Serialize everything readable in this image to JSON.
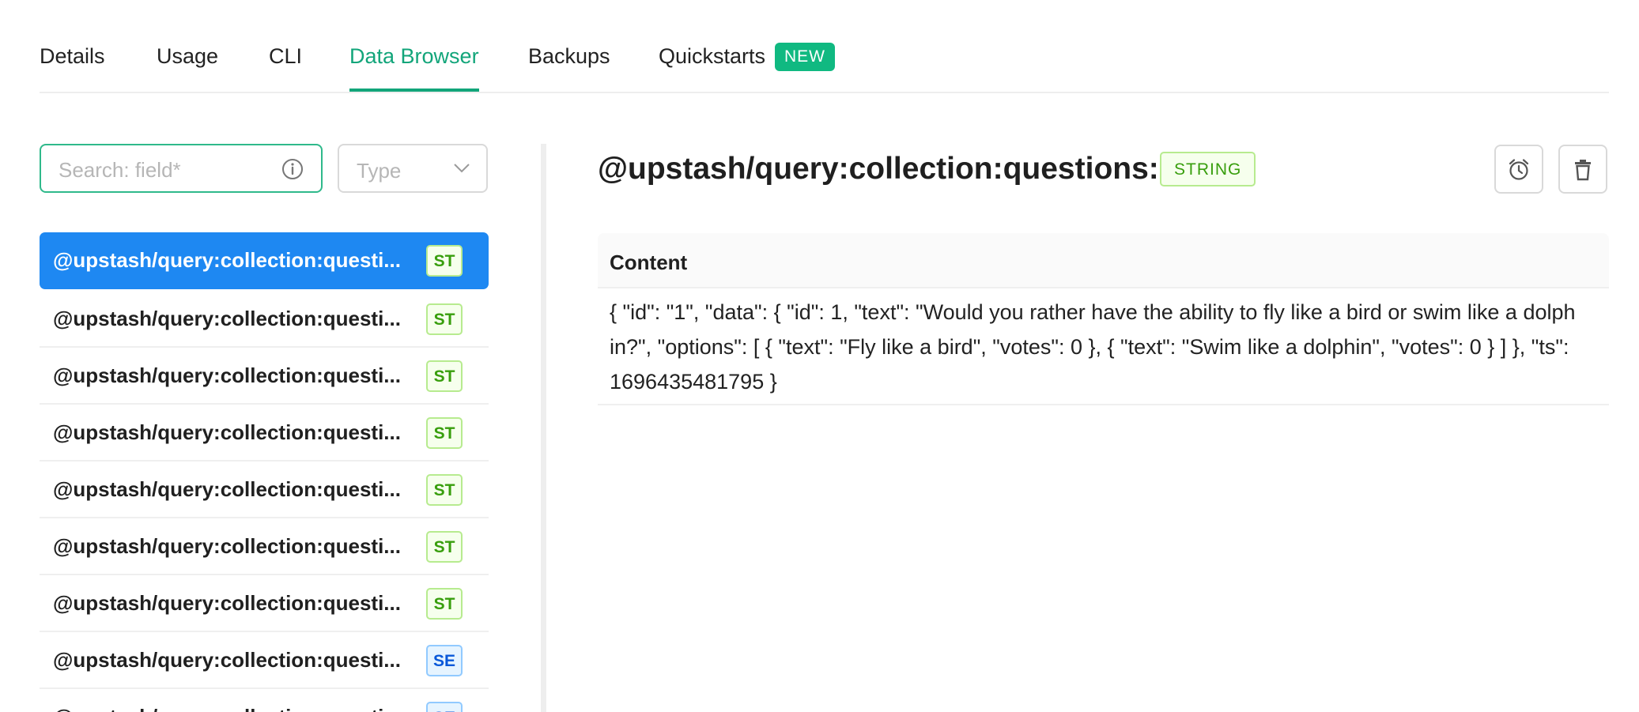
{
  "tabs": [
    {
      "label": "Details"
    },
    {
      "label": "Usage"
    },
    {
      "label": "CLI"
    },
    {
      "label": "Data Browser",
      "active": true
    },
    {
      "label": "Backups"
    },
    {
      "label": "Quickstarts",
      "badge": "NEW"
    }
  ],
  "sidebar": {
    "search_placeholder": "Search: field*",
    "type_placeholder": "Type",
    "items": [
      {
        "key": "@upstash/query:collection:questi...",
        "type": "ST",
        "selected": true
      },
      {
        "key": "@upstash/query:collection:questi...",
        "type": "ST"
      },
      {
        "key": "@upstash/query:collection:questi...",
        "type": "ST"
      },
      {
        "key": "@upstash/query:collection:questi...",
        "type": "ST"
      },
      {
        "key": "@upstash/query:collection:questi...",
        "type": "ST"
      },
      {
        "key": "@upstash/query:collection:questi...",
        "type": "ST"
      },
      {
        "key": "@upstash/query:collection:questi...",
        "type": "ST"
      },
      {
        "key": "@upstash/query:collection:questi...",
        "type": "SE"
      },
      {
        "key": "@upstash/query:collection:questi...",
        "type": "SE"
      }
    ]
  },
  "detail": {
    "key": "@upstash/query:collection:questions:1",
    "type_tag": "STRING",
    "content_header": "Content",
    "content_value": "{ \"id\": \"1\", \"data\": { \"id\": 1, \"text\": \"Would you rather have the ability to fly like a bird or swim like a dolphin?\", \"options\": [ { \"text\": \"Fly like a bird\", \"votes\": 0 }, { \"text\": \"Swim like a dolphin\", \"votes\": 0 } ] }, \"ts\": 1696435481795 }",
    "actions": [
      {
        "icon": "alarm-clock-icon"
      },
      {
        "icon": "trash-icon"
      }
    ]
  },
  "colors": {
    "accent": "#12a57a",
    "selected_row": "#1e88f2",
    "new_badge": "#10b981"
  }
}
